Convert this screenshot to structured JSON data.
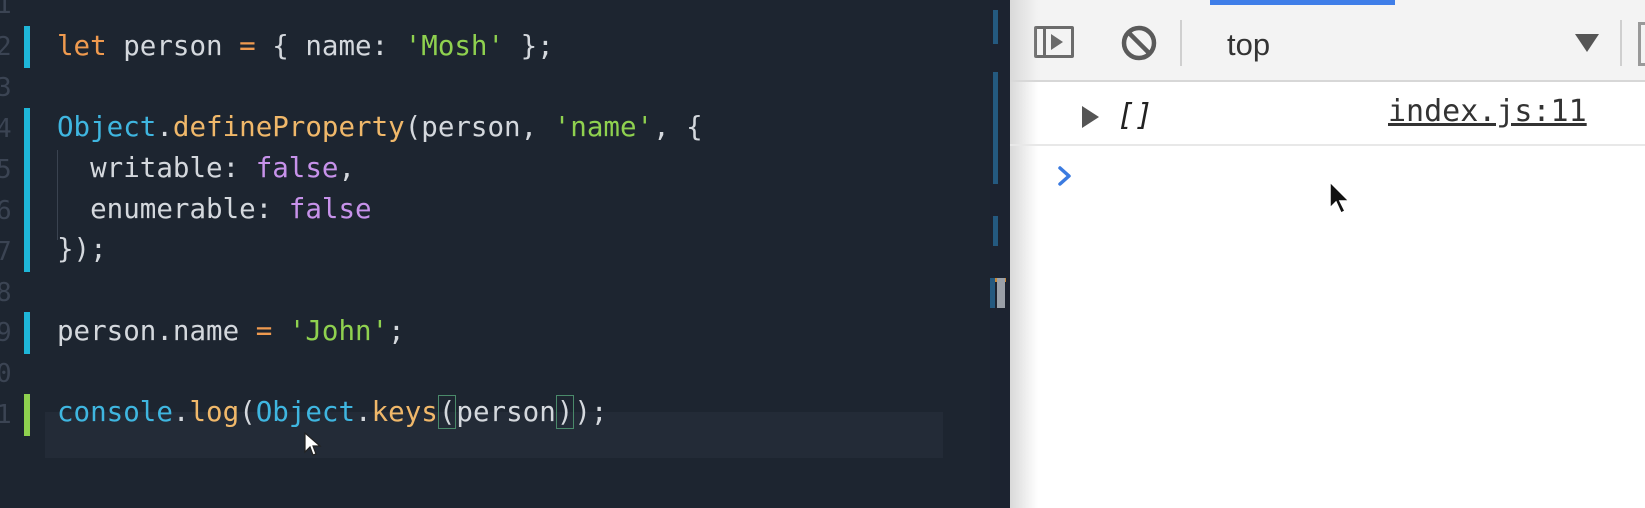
{
  "editor": {
    "line_numbers": [
      "1",
      "2",
      "3",
      "4",
      "5",
      "6",
      "7",
      "8",
      "9",
      "0",
      "1"
    ],
    "lines": {
      "l2": {
        "kw": "let",
        "var": " person ",
        "op": "=",
        "rest1": " { name: ",
        "str": "'Mosh'",
        "rest2": " };"
      },
      "l4": {
        "obj": "Object",
        "dot": ".",
        "fn": "defineProperty",
        "open": "(person, ",
        "str": "'name'",
        "close": ", {"
      },
      "l5": {
        "prop": "  writable: ",
        "bool": "false",
        "tail": ","
      },
      "l6": {
        "prop": "  enumerable: ",
        "bool": "false"
      },
      "l7": {
        "text": "});"
      },
      "l9": {
        "prop": "person.name ",
        "op": "=",
        "sp": " ",
        "str": "'John'",
        "tail": ";"
      },
      "l11": {
        "obj1": "console",
        "dot1": ".",
        "fn1": "log",
        "p1": "(",
        "obj2": "Object",
        "dot2": ".",
        "fn2": "keys",
        "p2": "(",
        "arg": "person",
        "p3": ")",
        "p4": ");"
      }
    }
  },
  "devtools": {
    "context": "top",
    "log": {
      "value": "[]",
      "source": "index.js:11"
    },
    "icons": {
      "sidebar": "sidebar-toggle-icon",
      "clear": "clear-console-icon",
      "dropdown": "dropdown-arrow-icon",
      "expand": "expand-triangle-icon",
      "prompt": "prompt-chevron-icon"
    },
    "colors": {
      "accent": "#3f7ee8",
      "prompt": "#3b7be0"
    }
  }
}
